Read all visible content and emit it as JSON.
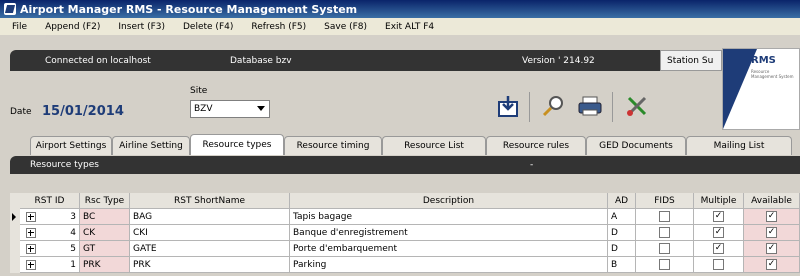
{
  "window": {
    "title": "Airport Manager RMS - Resource Management System"
  },
  "menu": [
    "File",
    "Append (F2)",
    "Insert (F3)",
    "Delete (F4)",
    "Refresh (F5)",
    "Save (F8)",
    "Exit ALT F4"
  ],
  "connection": {
    "connected_label": "Connected on  localhost",
    "database_label": "Database  bzv",
    "version_label": "Version  ' 214.92"
  },
  "station": {
    "label": "Station Su"
  },
  "logo": {
    "text": "RMS",
    "subtext": "Resource Management System"
  },
  "date": {
    "label": "Date",
    "value": "15/01/2014"
  },
  "site": {
    "label": "Site",
    "value": "BZV"
  },
  "toolbar": {
    "icons": [
      "export-icon",
      "search-icon",
      "print-icon",
      "tools-icon"
    ]
  },
  "tabs": [
    "Airport Settings",
    "Airline Setting",
    "Resource types",
    "Resource timing",
    "Resource List",
    "Resource rules",
    "GED Documents",
    "Mailing List"
  ],
  "active_tab": "Resource types",
  "section": {
    "title": "Resource types",
    "dash": "-"
  },
  "table": {
    "headers": [
      "RST ID",
      "Rsc Type",
      "RST ShortName",
      "Description",
      "AD",
      "FIDS",
      "Multiple",
      "Available"
    ],
    "rows": [
      {
        "id": "3",
        "type": "BC",
        "short": "BAG",
        "desc": "Tapis bagage",
        "ad": "A",
        "fids": false,
        "multiple": true,
        "available": true
      },
      {
        "id": "4",
        "type": "CK",
        "short": "CKI",
        "desc": "Banque d'enregistrement",
        "ad": "D",
        "fids": false,
        "multiple": true,
        "available": true
      },
      {
        "id": "5",
        "type": "GT",
        "short": "GATE",
        "desc": "Porte d'embarquement",
        "ad": "D",
        "fids": false,
        "multiple": true,
        "available": true
      },
      {
        "id": "1",
        "type": "PRK",
        "short": "PRK",
        "desc": "Parking",
        "ad": "B",
        "fids": false,
        "multiple": false,
        "available": true
      }
    ]
  }
}
